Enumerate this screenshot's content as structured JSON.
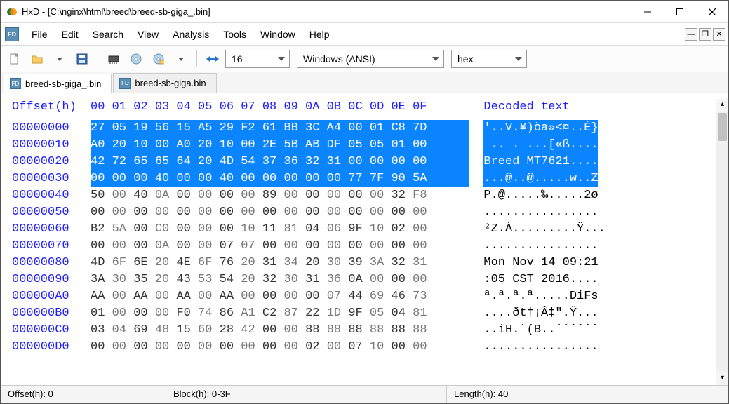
{
  "window": {
    "title": "HxD - [C:\\nginx\\html\\breed\\breed-sb-giga_.bin]"
  },
  "menu": {
    "items": [
      "File",
      "Edit",
      "Search",
      "View",
      "Analysis",
      "Tools",
      "Window",
      "Help"
    ]
  },
  "toolbar": {
    "column_count": "16",
    "encoding": "Windows (ANSI)",
    "number_base": "hex"
  },
  "tabs": [
    {
      "label": "breed-sb-giga_.bin",
      "active": true
    },
    {
      "label": "breed-sb-giga.bin",
      "active": false
    }
  ],
  "hex": {
    "header_offset": "Offset(h)",
    "header_cols": "00 01 02 03 04 05 06 07 08 09 0A 0B 0C 0D 0E 0F",
    "header_decoded": "Decoded text",
    "rows": [
      {
        "addr": "00000000",
        "bytes": "27 05 19 56 15 A5 29 F2 61 BB 3C A4 00 01 C8 7D",
        "text": "'..V.¥)òa»<¤..È}",
        "sel": true
      },
      {
        "addr": "00000010",
        "bytes": "A0 20 10 00 A0 20 10 00 2E 5B AB DF 05 05 01 00",
        "text": " .. . ...[«ß....",
        "sel": true
      },
      {
        "addr": "00000020",
        "bytes": "42 72 65 65 64 20 4D 54 37 36 32 31 00 00 00 00",
        "text": "Breed MT7621....",
        "sel": true
      },
      {
        "addr": "00000030",
        "bytes": "00 00 00 40 00 00 40 00 00 00 00 00 77 7F 90 5A",
        "text": "...@..@.....w..Z",
        "sel": true
      },
      {
        "addr": "00000040",
        "bytes": "50 00 40 0A 00 00 00 00 89 00 00 00 00 00 32 F8",
        "text": "P.@.....‰.....2ø",
        "sel": false
      },
      {
        "addr": "00000050",
        "bytes": "00 00 00 00 00 00 00 00 00 00 00 00 00 00 00 00",
        "text": "................",
        "sel": false
      },
      {
        "addr": "00000060",
        "bytes": "B2 5A 00 C0 00 00 00 10 11 81 04 06 9F 10 02 00",
        "text": "²Z.À.........Ÿ...",
        "sel": false
      },
      {
        "addr": "00000070",
        "bytes": "00 00 00 0A 00 00 07 07 00 00 00 00 00 00 00 00",
        "text": "................",
        "sel": false
      },
      {
        "addr": "00000080",
        "bytes": "4D 6F 6E 20 4E 6F 76 20 31 34 20 30 39 3A 32 31",
        "text": "Mon Nov 14 09:21",
        "sel": false
      },
      {
        "addr": "00000090",
        "bytes": "3A 30 35 20 43 53 54 20 32 30 31 36 0A 00 00 00",
        "text": ":05 CST 2016....",
        "sel": false
      },
      {
        "addr": "000000A0",
        "bytes": "AA 00 AA 00 AA 00 AA 00 00 00 00 07 44 69 46 73",
        "text": "ª.ª.ª.ª.....DiFs",
        "sel": false
      },
      {
        "addr": "000000B0",
        "bytes": "01 00 00 00 F0 74 86 A1 C2 87 22 1D 9F 05 04 81",
        "text": "....ðt†¡Â‡\".Ÿ...",
        "sel": false
      },
      {
        "addr": "000000C0",
        "bytes": "03 04 69 48 15 60 28 42 00 00 88 88 88 88 88 88",
        "text": "..iH.`(B..ˆˆˆˆˆˆ",
        "sel": false
      },
      {
        "addr": "000000D0",
        "bytes": "00 00 00 00 00 00 00 00 00 00 02 00 07 10 00 00",
        "text": "................",
        "sel": false
      }
    ]
  },
  "status": {
    "offset": "Offset(h): 0",
    "block": "Block(h): 0-3F",
    "length": "Length(h): 40"
  }
}
